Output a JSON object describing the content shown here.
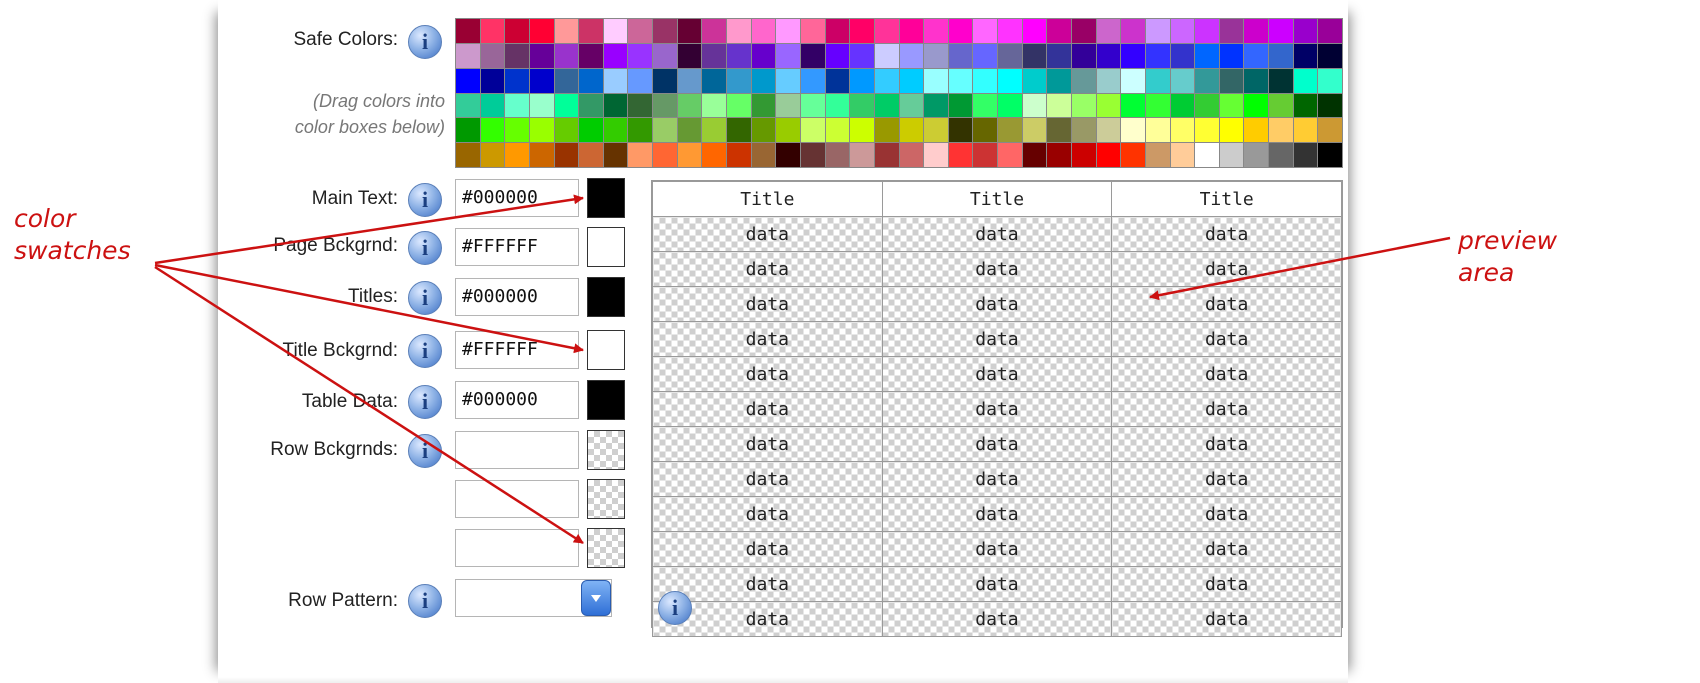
{
  "labels": {
    "safe_colors": "Safe Colors:",
    "hint_line1": "(Drag colors into",
    "hint_line2": "color boxes below)",
    "main_text": "Main Text:",
    "page_bckgrnd": "Page Bckgrnd:",
    "titles": "Titles:",
    "title_bckgrnd": "Title Bckgrnd:",
    "table_data": "Table Data:",
    "row_bckgrnds": "Row Bckgrnds:",
    "row_pattern": "Row Pattern:"
  },
  "fields": {
    "main_text": "#000000",
    "page_bckgrnd": "#FFFFFF",
    "titles": "#000000",
    "title_bckgrnd": "#FFFFFF",
    "table_data": "#000000",
    "row_bckgrnd_1": "",
    "row_bckgrnd_2": "",
    "row_bckgrnd_3": "",
    "row_pattern": ""
  },
  "swatch_colors": {
    "main_text": "#000000",
    "page_bckgrnd": "#FFFFFF",
    "titles": "#000000",
    "title_bckgrnd": "#FFFFFF",
    "table_data": "#000000"
  },
  "info_icon_glyph": "i",
  "preview": {
    "headers": [
      "Title",
      "Title",
      "Title"
    ],
    "rows": [
      [
        "data",
        "data",
        "data"
      ],
      [
        "data",
        "data",
        "data"
      ],
      [
        "data",
        "data",
        "data"
      ],
      [
        "data",
        "data",
        "data"
      ],
      [
        "data",
        "data",
        "data"
      ],
      [
        "data",
        "data",
        "data"
      ],
      [
        "data",
        "data",
        "data"
      ],
      [
        "data",
        "data",
        "data"
      ],
      [
        "data",
        "data",
        "data"
      ],
      [
        "data",
        "data",
        "data"
      ],
      [
        "data",
        "data",
        "data"
      ],
      [
        "data",
        "data",
        "data"
      ]
    ]
  },
  "annotations": {
    "swatches_line1": "color",
    "swatches_line2": "swatches",
    "preview_line1": "preview",
    "preview_line2": "area",
    "color": "#cc1111"
  },
  "palette": [
    [
      "#990033",
      "#FF3366",
      "#CC0033",
      "#FF0033",
      "#FF9999",
      "#CC3366",
      "#FFCCFF",
      "#CC6699",
      "#993366",
      "#660033",
      "#CC3399",
      "#FF99CC",
      "#FF66CC",
      "#FF99FF",
      "#FF6699",
      "#CC0066",
      "#FF0066",
      "#FF3399",
      "#FF0099",
      "#FF33CC",
      "#FF00CC",
      "#FF66FF",
      "#FF33FF",
      "#FF00FF",
      "#CC0099",
      "#990066",
      "#CC66CC",
      "#CC33CC",
      "#CC99FF",
      "#CC66FF",
      "#CC33FF",
      "#993399",
      "#CC00CC",
      "#CC00FF",
      "#9900CC",
      "#990099"
    ],
    [
      "#CC99CC",
      "#996699",
      "#663366",
      "#660099",
      "#9933CC",
      "#660066",
      "#9900FF",
      "#9933FF",
      "#9966CC",
      "#330033",
      "#663399",
      "#6633CC",
      "#6600CC",
      "#9966FF",
      "#330066",
      "#6600FF",
      "#6633FF",
      "#CCCCFF",
      "#9999FF",
      "#9999CC",
      "#6666CC",
      "#6666FF",
      "#666699",
      "#333366",
      "#333399",
      "#330099",
      "#3300CC",
      "#3300FF",
      "#3333FF",
      "#3333CC",
      "#0066FF",
      "#0033FF",
      "#3366FF",
      "#3366CC",
      "#000066",
      "#000033"
    ],
    [
      "#0000FF",
      "#000099",
      "#0033CC",
      "#0000CC",
      "#336699",
      "#0066CC",
      "#99CCFF",
      "#6699FF",
      "#003366",
      "#6699CC",
      "#006699",
      "#3399CC",
      "#0099CC",
      "#66CCFF",
      "#3399FF",
      "#003399",
      "#0099FF",
      "#33CCFF",
      "#00CCFF",
      "#99FFFF",
      "#66FFFF",
      "#33FFFF",
      "#00FFFF",
      "#00CCCC",
      "#009999",
      "#669999",
      "#99CCCC",
      "#CCFFFF",
      "#33CCCC",
      "#66CCCC",
      "#339999",
      "#336666",
      "#006666",
      "#003333",
      "#00FFCC",
      "#33FFCC"
    ],
    [
      "#33CC99",
      "#00CC99",
      "#66FFCC",
      "#99FFCC",
      "#00FF99",
      "#339966",
      "#006633",
      "#336633",
      "#669966",
      "#66CC66",
      "#99FF99",
      "#66FF66",
      "#339933",
      "#99CC99",
      "#66FF99",
      "#33FF99",
      "#33CC66",
      "#00CC66",
      "#66CC99",
      "#009966",
      "#009933",
      "#33FF66",
      "#00FF66",
      "#CCFFCC",
      "#CCFF99",
      "#99FF66",
      "#99FF33",
      "#00FF33",
      "#33FF33",
      "#00CC33",
      "#33CC33",
      "#66FF33",
      "#00FF00",
      "#66CC33",
      "#006600",
      "#003300"
    ],
    [
      "#009900",
      "#33FF00",
      "#66FF00",
      "#99FF00",
      "#66CC00",
      "#00CC00",
      "#33CC00",
      "#339900",
      "#99CC66",
      "#669933",
      "#99CC33",
      "#336600",
      "#669900",
      "#99CC00",
      "#CCFF66",
      "#CCFF33",
      "#CCFF00",
      "#999900",
      "#CCCC00",
      "#CCCC33",
      "#333300",
      "#666600",
      "#999933",
      "#CCCC66",
      "#666633",
      "#999966",
      "#CCCC99",
      "#FFFFCC",
      "#FFFF99",
      "#FFFF66",
      "#FFFF33",
      "#FFFF00",
      "#FFCC00",
      "#FFCC66",
      "#FFCC33",
      "#CC9933"
    ],
    [
      "#996600",
      "#CC9900",
      "#FF9900",
      "#CC6600",
      "#993300",
      "#CC6633",
      "#663300",
      "#FF9966",
      "#FF6633",
      "#FF9933",
      "#FF6600",
      "#CC3300",
      "#996633",
      "#330000",
      "#663333",
      "#996666",
      "#CC9999",
      "#993333",
      "#CC6666",
      "#FFCCCC",
      "#FF3333",
      "#CC3333",
      "#FF6666",
      "#660000",
      "#990000",
      "#CC0000",
      "#FF0000",
      "#FF3300",
      "#CC9966",
      "#FFCC99",
      "#FFFFFF",
      "#CCCCCC",
      "#999999",
      "#666666",
      "#333333",
      "#000000"
    ]
  ]
}
